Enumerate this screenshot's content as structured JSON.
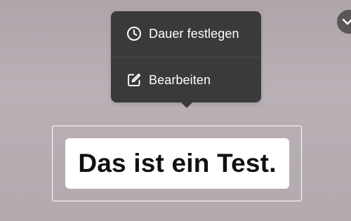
{
  "context_menu": {
    "items": [
      {
        "label": "Dauer festlegen",
        "icon": "clock-icon"
      },
      {
        "label": "Bearbeiten",
        "icon": "edit-icon"
      }
    ]
  },
  "text_overlay": {
    "text": "Das ist ein Test."
  },
  "corner_button": {
    "icon": "chevron-down-icon"
  },
  "colors": {
    "menu_background": "#3a393b",
    "menu_text": "#ffffff",
    "text_background": "#ffffff",
    "text_color": "#111111",
    "canvas_background": "#b3aab0"
  }
}
